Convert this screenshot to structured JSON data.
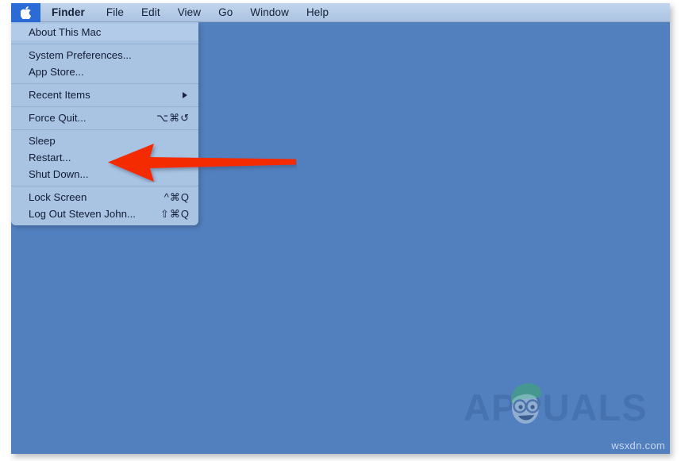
{
  "desktop": {
    "background_color": "#5280bf",
    "watermark_text": "APPUALS",
    "watermark_icon": "appuals-mascot-icon",
    "source_label": "wsxdn.com"
  },
  "menubar": {
    "background_color": "#b6cce7",
    "apple_icon": "apple-logo-icon",
    "apple_highlight_color": "#2a6bd6",
    "items": [
      {
        "label": "Finder",
        "bold": true
      },
      {
        "label": "File",
        "bold": false
      },
      {
        "label": "Edit",
        "bold": false
      },
      {
        "label": "View",
        "bold": false
      },
      {
        "label": "Go",
        "bold": false
      },
      {
        "label": "Window",
        "bold": false
      },
      {
        "label": "Help",
        "bold": false
      }
    ]
  },
  "apple_menu": {
    "background_color": "#a9c3e3",
    "highlight_color": "#b2cbe9",
    "groups": [
      {
        "items": [
          {
            "label": "About This Mac",
            "shortcut": "",
            "submenu": false,
            "highlighted": true
          }
        ]
      },
      {
        "items": [
          {
            "label": "System Preferences...",
            "shortcut": "",
            "submenu": false,
            "highlighted": false
          },
          {
            "label": "App Store...",
            "shortcut": "",
            "submenu": false,
            "highlighted": false
          }
        ]
      },
      {
        "items": [
          {
            "label": "Recent Items",
            "shortcut": "",
            "submenu": true,
            "highlighted": false
          }
        ]
      },
      {
        "items": [
          {
            "label": "Force Quit...",
            "shortcut": "⌥⌘↺",
            "submenu": false,
            "highlighted": false
          }
        ]
      },
      {
        "items": [
          {
            "label": "Sleep",
            "shortcut": "",
            "submenu": false,
            "highlighted": false
          },
          {
            "label": "Restart...",
            "shortcut": "",
            "submenu": false,
            "highlighted": false
          },
          {
            "label": "Shut Down...",
            "shortcut": "",
            "submenu": false,
            "highlighted": false
          }
        ]
      },
      {
        "items": [
          {
            "label": "Lock Screen",
            "shortcut": "^⌘Q",
            "submenu": false,
            "highlighted": false
          },
          {
            "label": "Log Out Steven John...",
            "shortcut": "⇧⌘Q",
            "submenu": false,
            "highlighted": false
          }
        ]
      }
    ]
  },
  "annotation": {
    "arrow_color": "#f42a00",
    "arrow_points_to": "Restart..."
  }
}
